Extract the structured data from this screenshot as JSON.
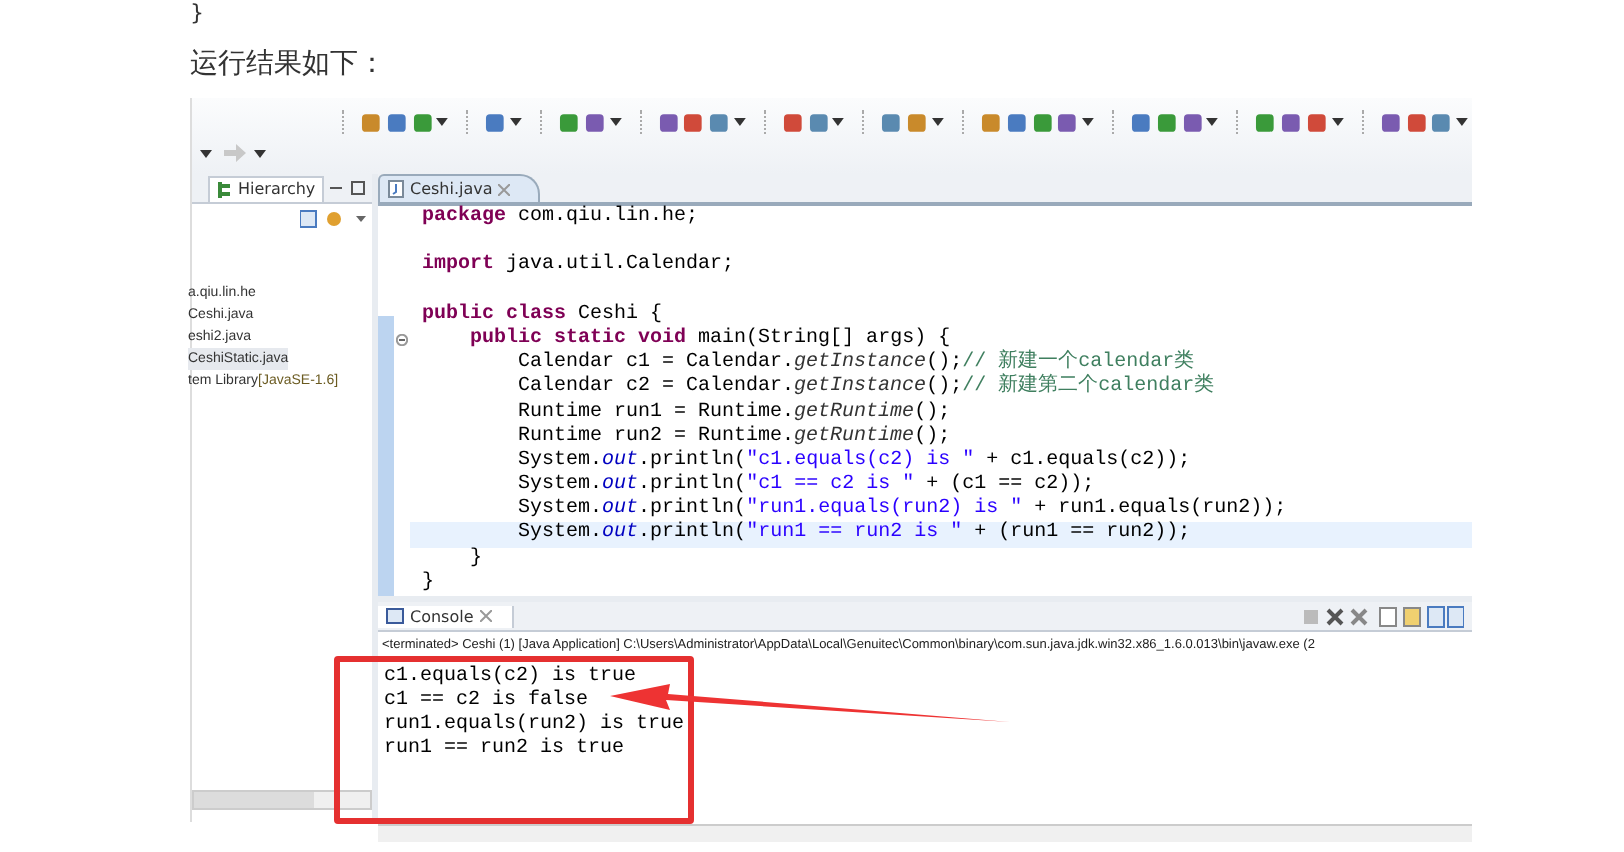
{
  "article": {
    "brace": "}",
    "caption": "运行结果如下："
  },
  "ide": {
    "left_panel": {
      "tab": "Hierarchy",
      "tree": [
        {
          "label": "a.qiu.lin.he",
          "selected": false
        },
        {
          "label": "Ceshi.java",
          "selected": false
        },
        {
          "label": "eshi2.java",
          "selected": false
        },
        {
          "label": "CeshiStatic.java",
          "selected": true
        },
        {
          "label": "tem Library",
          "suffix": "[JavaSE-1.6]",
          "selected": false
        }
      ]
    },
    "editor": {
      "tab": "Ceshi.java",
      "lines": [
        {
          "kind": "code",
          "current": false,
          "fold": false,
          "tokens": [
            {
              "kind": "keyword",
              "text": "package"
            },
            {
              "kind": "plain",
              "text": " com.qiu.lin.he;"
            }
          ]
        },
        {
          "kind": "blank"
        },
        {
          "kind": "code",
          "current": false,
          "fold": false,
          "tokens": [
            {
              "kind": "keyword",
              "text": "import"
            },
            {
              "kind": "plain",
              "text": " java.util.Calendar;"
            }
          ]
        },
        {
          "kind": "blank"
        },
        {
          "kind": "code",
          "current": false,
          "fold": false,
          "tokens": [
            {
              "kind": "keyword",
              "text": "public class"
            },
            {
              "kind": "plain",
              "text": " Ceshi {"
            }
          ]
        },
        {
          "kind": "code",
          "current": false,
          "fold": true,
          "tokens": [
            {
              "kind": "keyword",
              "text": "    public static void"
            },
            {
              "kind": "plain",
              "text": " main(String[] args) {"
            }
          ]
        },
        {
          "kind": "code",
          "current": false,
          "fold": false,
          "tokens": [
            {
              "kind": "plain",
              "text": "        Calendar c1 = Calendar."
            },
            {
              "kind": "static",
              "text": "getInstance"
            },
            {
              "kind": "plain",
              "text": "();"
            },
            {
              "kind": "comment",
              "text": "// 新建一个calendar类"
            }
          ]
        },
        {
          "kind": "code",
          "current": false,
          "fold": false,
          "tokens": [
            {
              "kind": "plain",
              "text": "        Calendar c2 = Calendar."
            },
            {
              "kind": "static",
              "text": "getInstance"
            },
            {
              "kind": "plain",
              "text": "();"
            },
            {
              "kind": "comment",
              "text": "// 新建第二个calendar类"
            }
          ]
        },
        {
          "kind": "code",
          "current": false,
          "fold": false,
          "tokens": [
            {
              "kind": "plain",
              "text": "        Runtime run1 = Runtime."
            },
            {
              "kind": "static",
              "text": "getRuntime"
            },
            {
              "kind": "plain",
              "text": "();"
            }
          ]
        },
        {
          "kind": "code",
          "current": false,
          "fold": false,
          "tokens": [
            {
              "kind": "plain",
              "text": "        Runtime run2 = Runtime."
            },
            {
              "kind": "static",
              "text": "getRuntime"
            },
            {
              "kind": "plain",
              "text": "();"
            }
          ]
        },
        {
          "kind": "code",
          "current": false,
          "fold": false,
          "tokens": [
            {
              "kind": "plain",
              "text": "        System."
            },
            {
              "kind": "field",
              "text": "out"
            },
            {
              "kind": "plain",
              "text": ".println("
            },
            {
              "kind": "string",
              "text": "\"c1.equals(c2) is \""
            },
            {
              "kind": "plain",
              "text": " + c1.equals(c2));"
            }
          ]
        },
        {
          "kind": "code",
          "current": false,
          "fold": false,
          "tokens": [
            {
              "kind": "plain",
              "text": "        System."
            },
            {
              "kind": "field",
              "text": "out"
            },
            {
              "kind": "plain",
              "text": ".println("
            },
            {
              "kind": "string",
              "text": "\"c1 == c2 is \""
            },
            {
              "kind": "plain",
              "text": " + (c1 == c2));"
            }
          ]
        },
        {
          "kind": "code",
          "current": false,
          "fold": false,
          "tokens": [
            {
              "kind": "plain",
              "text": "        System."
            },
            {
              "kind": "field",
              "text": "out"
            },
            {
              "kind": "plain",
              "text": ".println("
            },
            {
              "kind": "string",
              "text": "\"run1.equals(run2) is \""
            },
            {
              "kind": "plain",
              "text": " + run1.equals(run2));"
            }
          ]
        },
        {
          "kind": "code",
          "current": true,
          "fold": false,
          "tokens": [
            {
              "kind": "plain",
              "text": "        System."
            },
            {
              "kind": "field",
              "text": "out"
            },
            {
              "kind": "plain",
              "text": ".println("
            },
            {
              "kind": "string",
              "text": "\"run1 == run2 is \""
            },
            {
              "kind": "plain",
              "text": " + (run1 == run2));"
            }
          ]
        },
        {
          "kind": "code",
          "current": false,
          "fold": false,
          "tokens": [
            {
              "kind": "plain",
              "text": "    }"
            }
          ]
        },
        {
          "kind": "code",
          "current": false,
          "fold": false,
          "tokens": [
            {
              "kind": "plain",
              "text": "}"
            }
          ]
        }
      ]
    },
    "console": {
      "tab": "Console",
      "status": "<terminated> Ceshi (1) [Java Application] C:\\Users\\Administrator\\AppData\\Local\\Genuitec\\Common\\binary\\com.sun.java.jdk.win32.x86_1.6.0.013\\bin\\javaw.exe (2",
      "output": [
        {
          "text": "c1.equals(c2) is true",
          "pointed": false
        },
        {
          "text": "c1 == c2 is false",
          "pointed": true
        },
        {
          "text": "run1.equals(run2) is true",
          "pointed": false
        },
        {
          "text": "run1 == run2 is true",
          "pointed": false
        }
      ],
      "highlight_box": true
    }
  }
}
